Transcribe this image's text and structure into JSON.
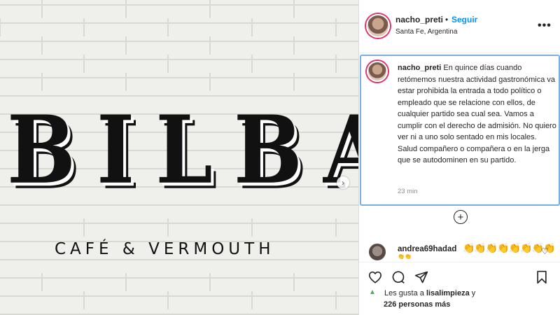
{
  "post_image": {
    "brand_title": "BILBAO",
    "brand_subtitle": "CAFÉ & VERMOUTH"
  },
  "header": {
    "username": "nacho_preti",
    "separator": "•",
    "follow_label": "Seguir",
    "location": "Santa Fe, Argentina",
    "more_icon": "more-options-icon"
  },
  "caption": {
    "username": "nacho_preti",
    "text": "En quince días cuando retómemos nuestra actividad gastronómica va estar prohibida la entrada a todo político o empleado que se relacione con ellos, de cualquier partido sea cual sea. Vamos a cumplir con el derecho de admisión. No quiero ver ni a uno solo sentado en mis locales. Salud compañero o compañera o en la jerga que se autodominen en su partido.",
    "time": "23 min"
  },
  "comment": {
    "username": "andrea69hadad",
    "emojis": "👏👏👏👏👏👏👏👏",
    "emoji_line2": "👏👏"
  },
  "likes": {
    "prefix": "Les gusta a",
    "user": "lisalimpieza",
    "conj": "y",
    "count_text": "226 personas más"
  },
  "colors": {
    "follow_blue": "#0095f6",
    "highlight_border": "#79aee0"
  }
}
